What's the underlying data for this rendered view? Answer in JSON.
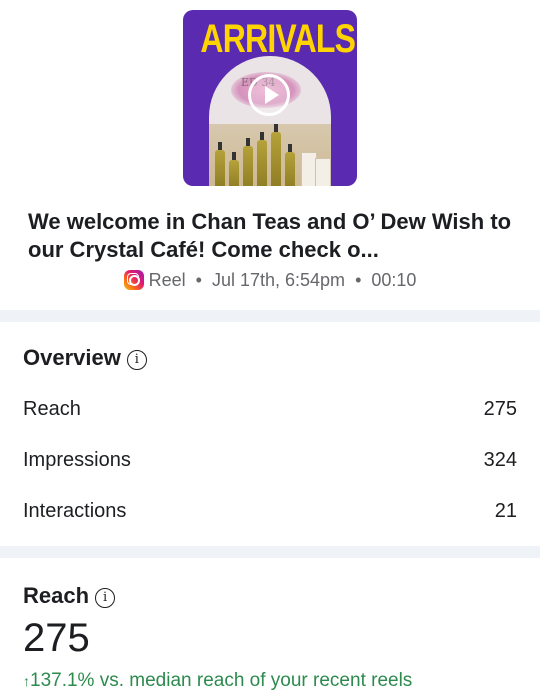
{
  "thumbnail": {
    "banner_text": "ARRIVALS",
    "floral_text": "ED 34"
  },
  "post": {
    "title": "We welcome in Chan Teas and O’ Dew Wish to our Crystal Café! Come check o...",
    "type": "Reel",
    "date": "Jul 17th, 6:54pm",
    "duration": "00:10",
    "separator": "•"
  },
  "overview": {
    "title": "Overview",
    "info": "i",
    "rows": [
      {
        "label": "Reach",
        "value": "275"
      },
      {
        "label": "Impressions",
        "value": "324"
      },
      {
        "label": "Interactions",
        "value": "21"
      }
    ]
  },
  "reach": {
    "title": "Reach",
    "info": "i",
    "value": "275",
    "delta_arrow": "↑",
    "delta_text": "137.1% vs. median reach of your recent reels",
    "delta_color": "#2d8a4e"
  }
}
